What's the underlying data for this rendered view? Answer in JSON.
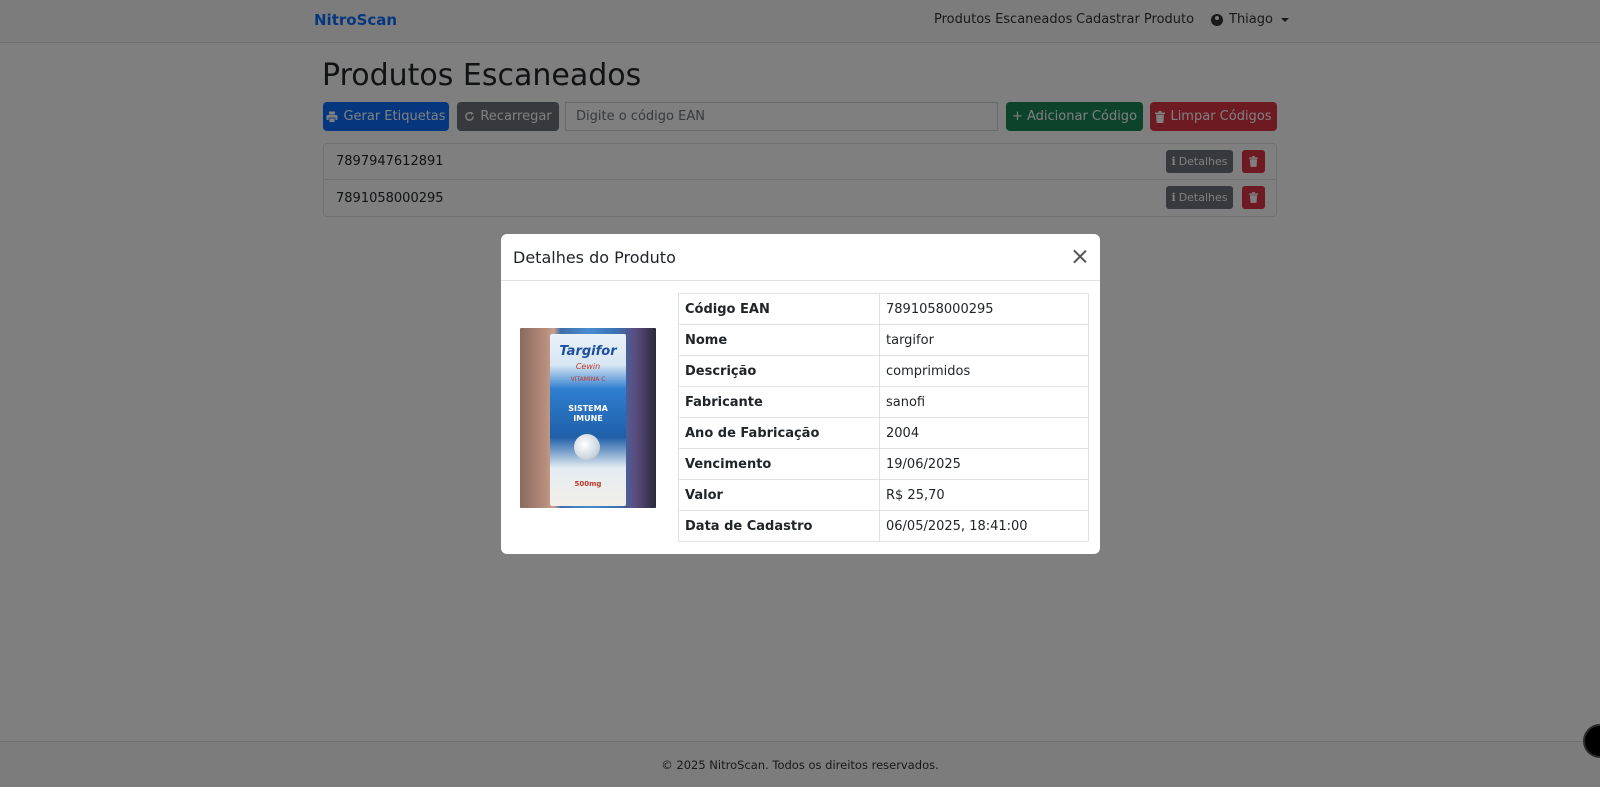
{
  "navbar": {
    "brand": "NitroScan",
    "links": [
      "Produtos Escaneados",
      "Cadastrar Produto"
    ],
    "user": "Thiago"
  },
  "page": {
    "title": "Produtos Escaneados"
  },
  "toolbar": {
    "generate_labels": "Gerar Etiquetas",
    "reload": "Recarregar",
    "ean_placeholder": "Digite o código EAN",
    "add_code": "+ Adicionar Código",
    "clear_codes": "Limpar Códigos"
  },
  "codes": [
    {
      "ean": "7897947612891",
      "details_label": "Detalhes"
    },
    {
      "ean": "7891058000295",
      "details_label": "Detalhes"
    }
  ],
  "modal": {
    "title": "Detalhes do Produto",
    "image_text": {
      "brand": "Targifor",
      "sub": "Cewin",
      "vitamin": "VITAMINA C",
      "line1": "SISTEMA",
      "line2": "IMUNE",
      "dose": "500mg"
    },
    "rows": [
      {
        "label": "Código EAN",
        "value": "7891058000295"
      },
      {
        "label": "Nome",
        "value": "targifor"
      },
      {
        "label": "Descrição",
        "value": "comprimidos"
      },
      {
        "label": "Fabricante",
        "value": "sanofi"
      },
      {
        "label": "Ano de Fabricação",
        "value": "2004"
      },
      {
        "label": "Vencimento",
        "value": "19/06/2025"
      },
      {
        "label": "Valor",
        "value": "R$ 25,70"
      },
      {
        "label": "Data de Cadastro",
        "value": "06/05/2025, 18:41:00"
      }
    ]
  },
  "footer": {
    "text": "© 2025 NitroScan. Todos os direitos reservados."
  },
  "colors": {
    "primary": "#0d6efd",
    "secondary": "#6c757d",
    "success": "#198754",
    "danger": "#dc3545"
  }
}
